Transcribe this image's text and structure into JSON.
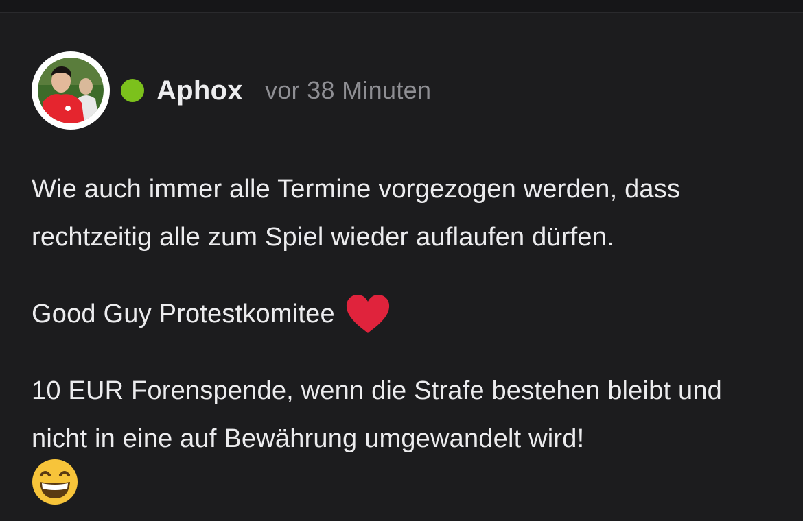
{
  "post": {
    "author": {
      "name": "Aphox",
      "status": "online",
      "status_color": "#7cc11c"
    },
    "timestamp": "vor 38 Minuten",
    "paragraphs": [
      "Wie auch immer alle Termine vorgezogen werden, dass rechtzeitig alle zum Spiel wieder auflaufen dürfen.",
      "Good Guy Protestkomitee",
      "10 EUR Forenspende, wenn die Strafe bestehen bleibt und nicht in eine auf Bewährung umgewandelt wird!"
    ],
    "emojis": [
      "heart-emoji",
      "grinning-face-emoji"
    ]
  },
  "colors": {
    "background": "#1c1c1e",
    "text": "#ececee",
    "muted": "#8e8e93",
    "heart": "#e0233c"
  }
}
